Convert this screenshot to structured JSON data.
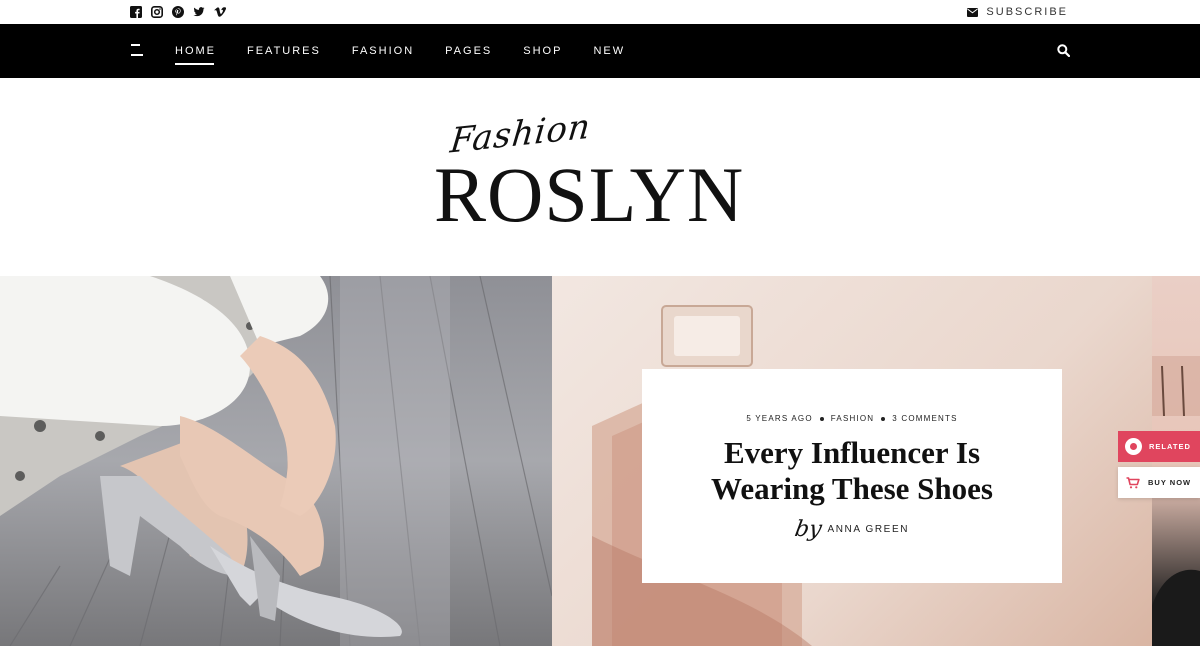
{
  "topbar": {
    "social_icons": [
      "facebook-icon",
      "instagram-icon",
      "pinterest-icon",
      "twitter-icon",
      "vimeo-icon"
    ],
    "subscribe_label": "SUBSCRIBE",
    "subscribe_icon": "envelope-icon"
  },
  "nav": {
    "items": [
      {
        "label": "HOME",
        "active": true
      },
      {
        "label": "FEATURES",
        "active": false
      },
      {
        "label": "FASHION",
        "active": false
      },
      {
        "label": "PAGES",
        "active": false
      },
      {
        "label": "SHOP",
        "active": false
      },
      {
        "label": "NEW",
        "active": false
      }
    ],
    "menu_icon": "hamburger-icon",
    "search_icon": "search-icon"
  },
  "logo": {
    "script": "Fashion",
    "brand": "ROSLYN"
  },
  "post": {
    "time": "5 YEARS AGO",
    "category": "FASHION",
    "comments": "3 COMMENTS",
    "title": "Every Influencer Is Wearing These Shoes",
    "by": "by",
    "author": "ANNA GREEN"
  },
  "widgets": {
    "related_label": "RELATED",
    "buy_label": "BUY NOW"
  },
  "colors": {
    "navbar": "#000000",
    "accent": "#e0455e",
    "text": "#111111"
  }
}
